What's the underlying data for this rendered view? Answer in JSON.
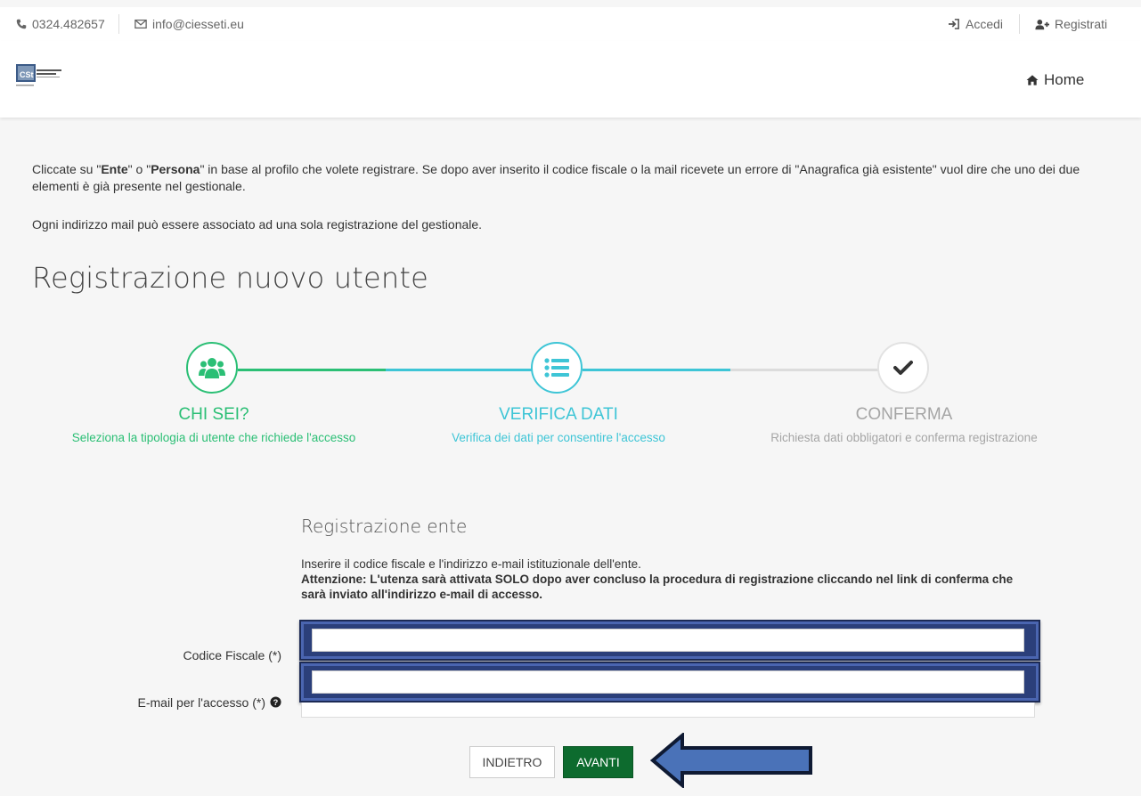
{
  "topbar": {
    "phone": "0324.482657",
    "email": "info@ciesseti.eu",
    "login": "Accedi",
    "register": "Registrati"
  },
  "header": {
    "home": "Home"
  },
  "intro": {
    "line1_pre": "Cliccate su \"",
    "line1_ente": "Ente",
    "line1_mid": "\" o \"",
    "line1_persona": "Persona",
    "line1_post": "\" in base al profilo che volete registrare. Se dopo aver inserito il codice fiscale o la mail ricevete un errore di \"Anagrafica già esistente\" vuol dire che uno dei due elementi è già presente nel gestionale.",
    "line2": "Ogni indirizzo mail può essere associato ad una sola registrazione del gestionale."
  },
  "page_title": "Registrazione nuovo utente",
  "wizard": {
    "steps": [
      {
        "title": "CHI SEI?",
        "subtitle": "Seleziona la tipologia di utente che richiede l'accesso",
        "icon": "users-icon",
        "color": "#2bbf75"
      },
      {
        "title": "VERIFICA DATI",
        "subtitle": "Verifica dei dati per consentire l'accesso",
        "icon": "list-icon",
        "color": "#3ec5d6"
      },
      {
        "title": "CONFERMA",
        "subtitle": "Richiesta dati obbligatori e conferma registrazione",
        "icon": "check-icon",
        "color": "#a5a5a5"
      }
    ]
  },
  "form": {
    "title": "Registrazione ente",
    "description": "Inserire il codice fiscale e l'indirizzo e-mail istituzionale dell'ente.",
    "warning": "Attenzione: L'utenza sarà attivata SOLO dopo aver concluso la procedura di registrazione cliccando nel link di conferma che sarà inviato all'indirizzo e-mail di accesso.",
    "fields": [
      {
        "label": "Codice Fiscale (*)",
        "value": ""
      },
      {
        "label": "E-mail per l'accesso (*)",
        "value": ""
      }
    ]
  },
  "buttons": {
    "back": "INDIETRO",
    "next": "AVANTI"
  }
}
